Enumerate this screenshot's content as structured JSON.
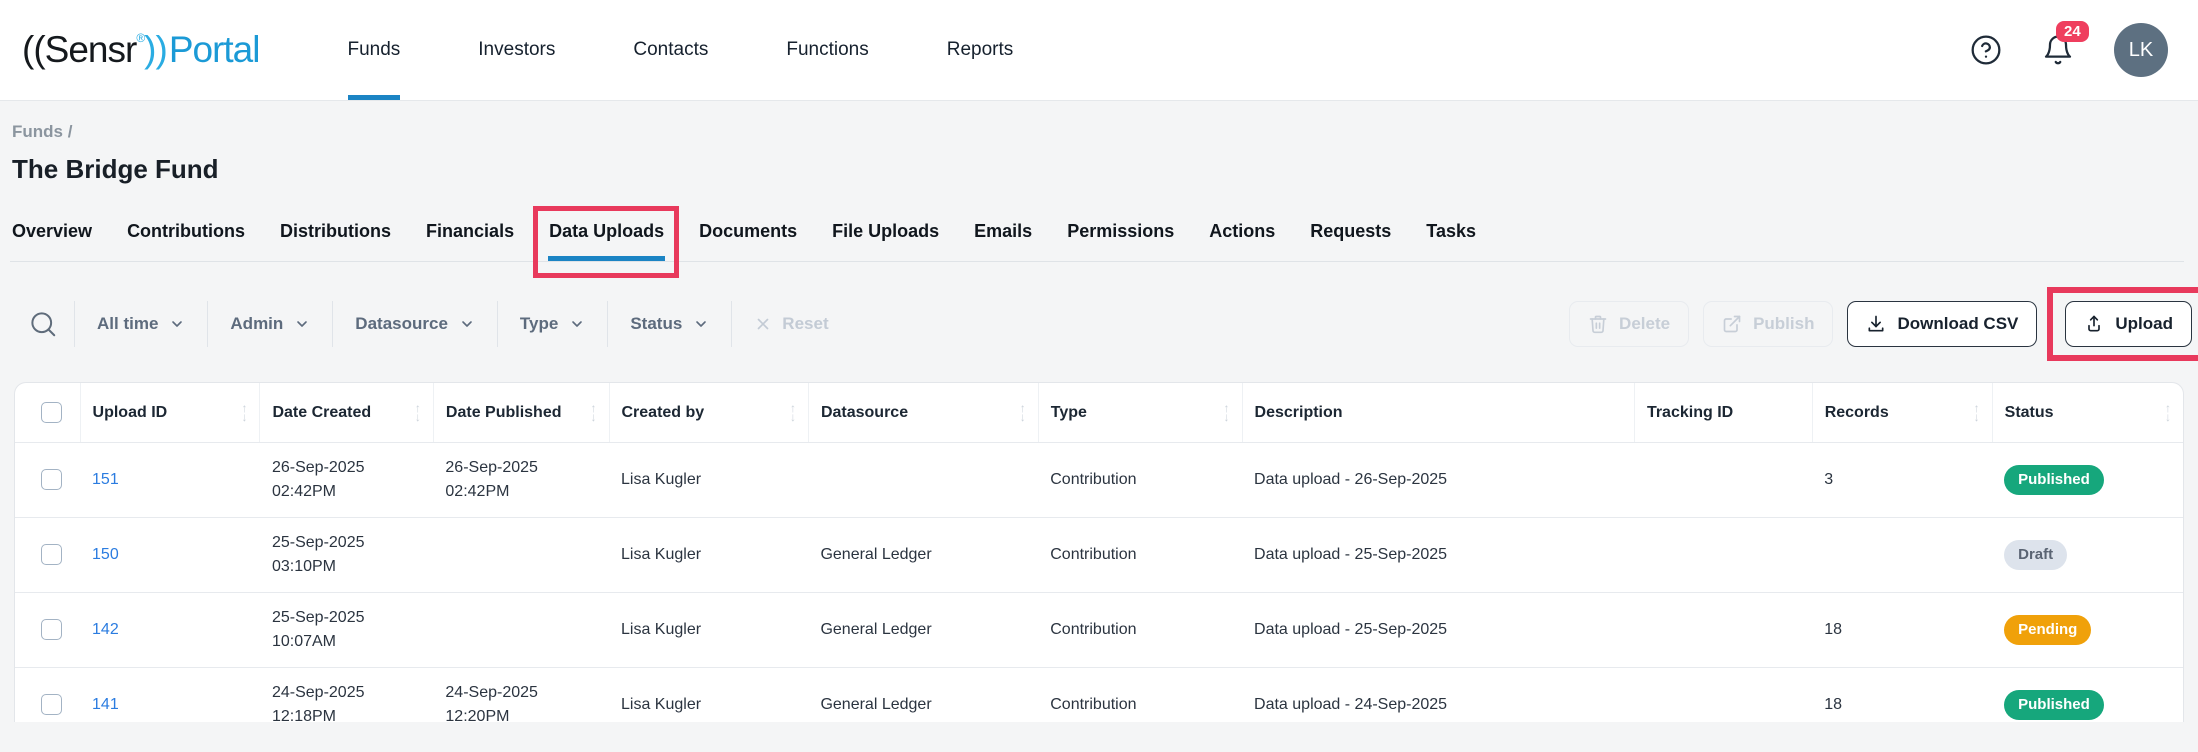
{
  "brand": {
    "logo_open": "((",
    "logo_name": "Sensr",
    "registered": "®",
    "logo_close": "))",
    "logo_product": "Portal"
  },
  "nav": {
    "items": [
      {
        "label": "Funds",
        "active": true
      },
      {
        "label": "Investors",
        "active": false
      },
      {
        "label": "Contacts",
        "active": false
      },
      {
        "label": "Functions",
        "active": false
      },
      {
        "label": "Reports",
        "active": false
      }
    ]
  },
  "header_icons": {
    "notification_count": "24",
    "avatar_initials": "LK"
  },
  "breadcrumb": {
    "path": "Funds /",
    "title": "The Bridge Fund"
  },
  "tabs": {
    "active": "Data Uploads",
    "items": [
      {
        "label": "Overview"
      },
      {
        "label": "Contributions"
      },
      {
        "label": "Distributions"
      },
      {
        "label": "Financials"
      },
      {
        "label": "Data Uploads"
      },
      {
        "label": "Documents"
      },
      {
        "label": "File Uploads"
      },
      {
        "label": "Emails"
      },
      {
        "label": "Permissions"
      },
      {
        "label": "Actions"
      },
      {
        "label": "Requests"
      },
      {
        "label": "Tasks"
      }
    ]
  },
  "toolbar": {
    "filters": [
      {
        "label": "All time"
      },
      {
        "label": "Admin"
      },
      {
        "label": "Datasource"
      },
      {
        "label": "Type"
      },
      {
        "label": "Status"
      }
    ],
    "reset_label": "Reset",
    "delete_label": "Delete",
    "publish_label": "Publish",
    "download_label": "Download CSV",
    "upload_label": "Upload"
  },
  "table": {
    "columns": [
      {
        "key": "id",
        "label": "Upload ID",
        "sortable": true
      },
      {
        "key": "created",
        "label": "Date Created",
        "sortable": true
      },
      {
        "key": "published",
        "label": "Date Published",
        "sortable": true
      },
      {
        "key": "createdby",
        "label": "Created by",
        "sortable": true
      },
      {
        "key": "datasource",
        "label": "Datasource",
        "sortable": true
      },
      {
        "key": "type",
        "label": "Type",
        "sortable": true
      },
      {
        "key": "description",
        "label": "Description",
        "sortable": false
      },
      {
        "key": "tracking",
        "label": "Tracking ID",
        "sortable": false
      },
      {
        "key": "records",
        "label": "Records",
        "sortable": true
      },
      {
        "key": "status",
        "label": "Status",
        "sortable": true
      }
    ],
    "rows": [
      {
        "id": "151",
        "date_created": [
          "26-Sep-2025",
          "02:42PM"
        ],
        "date_published": [
          "26-Sep-2025",
          "02:42PM"
        ],
        "created_by": "Lisa Kugler",
        "datasource": "",
        "type": "Contribution",
        "description": "Data upload - 26-Sep-2025",
        "tracking_id": "",
        "records": "3",
        "status": "Published"
      },
      {
        "id": "150",
        "date_created": [
          "25-Sep-2025",
          "03:10PM"
        ],
        "date_published": [],
        "created_by": "Lisa Kugler",
        "datasource": "General Ledger",
        "type": "Contribution",
        "description": "Data upload - 25-Sep-2025",
        "tracking_id": "",
        "records": "",
        "status": "Draft"
      },
      {
        "id": "142",
        "date_created": [
          "25-Sep-2025",
          "10:07AM"
        ],
        "date_published": [],
        "created_by": "Lisa Kugler",
        "datasource": "General Ledger",
        "type": "Contribution",
        "description": "Data upload - 25-Sep-2025",
        "tracking_id": "",
        "records": "18",
        "status": "Pending"
      },
      {
        "id": "141",
        "date_created": [
          "24-Sep-2025",
          "12:18PM"
        ],
        "date_published": [
          "24-Sep-2025",
          "12:20PM"
        ],
        "created_by": "Lisa Kugler",
        "datasource": "General Ledger",
        "type": "Contribution",
        "description": "Data upload - 24-Sep-2025",
        "tracking_id": "",
        "records": "18",
        "status": "Published"
      }
    ]
  },
  "colors": {
    "accent_blue": "#1b84c4",
    "annotation_red": "#e8395c",
    "link_blue": "#2b7ce0",
    "status_published": "#16a77c",
    "status_pending": "#f0a10a",
    "status_draft_bg": "#dde3ec",
    "status_draft_text": "#5a6473",
    "notification_red": "#ef3e5e",
    "avatar_bg": "#5d7081",
    "page_bg": "#f4f5f6"
  }
}
